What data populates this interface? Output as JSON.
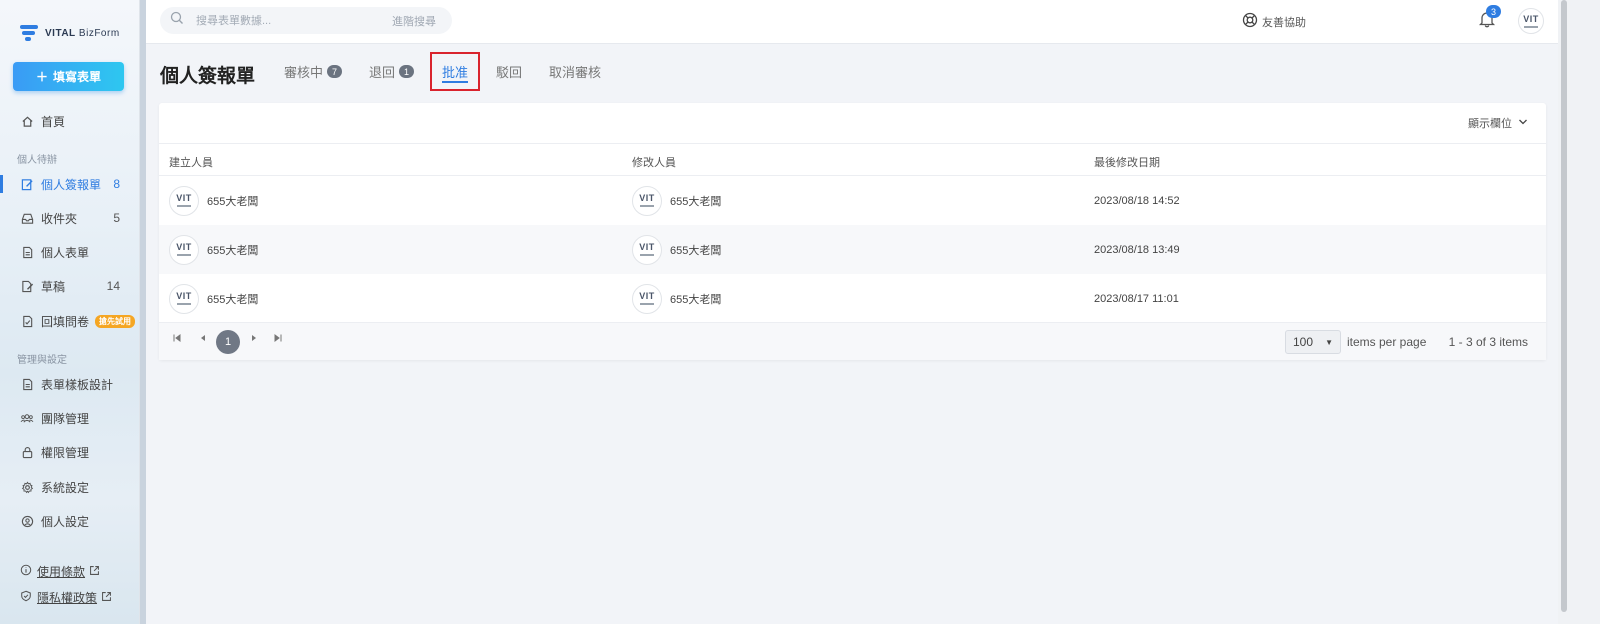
{
  "brand": {
    "name_bold": "VITAL",
    "name_light": " BizForm",
    "accent": "#2f7de1"
  },
  "sidebar": {
    "fill_button": "填寫表單",
    "home": "首頁",
    "section_personal": "個人待辦",
    "items": [
      {
        "label": "個人簽報單",
        "count": "8"
      },
      {
        "label": "收件夾",
        "count": "5"
      },
      {
        "label": "個人表單",
        "count": ""
      },
      {
        "label": "草稿",
        "count": "14"
      },
      {
        "label": "回填問卷",
        "badge": "搶先試用"
      }
    ],
    "section_admin": "管理與設定",
    "admin_items": [
      {
        "label": "表單樣板設計"
      },
      {
        "label": "團隊管理"
      },
      {
        "label": "權限管理"
      },
      {
        "label": "系統設定"
      },
      {
        "label": "個人設定"
      }
    ],
    "footer": {
      "terms": "使用條款",
      "privacy": "隱私權政策"
    }
  },
  "topbar": {
    "search_placeholder": "搜尋表單數據...",
    "advanced_search": "進階搜尋",
    "help": "友善協助",
    "notifications": "3",
    "avatar_text": "VIT"
  },
  "page": {
    "title": "個人簽報單",
    "tabs": [
      {
        "label": "審核中",
        "badge": "7"
      },
      {
        "label": "退回",
        "badge": "1"
      },
      {
        "label": "批准",
        "active": true
      },
      {
        "label": "駁回"
      },
      {
        "label": "取消審核"
      }
    ]
  },
  "table": {
    "column_toggle": "顯示欄位",
    "headers": [
      "建立人員",
      "修改人員",
      "最後修改日期"
    ],
    "rows": [
      {
        "creator": "655大老闆",
        "modifier": "655大老闆",
        "date": "2023/08/18 14:52"
      },
      {
        "creator": "655大老闆",
        "modifier": "655大老闆",
        "date": "2023/08/18 13:49"
      },
      {
        "creator": "655大老闆",
        "modifier": "655大老闆",
        "date": "2023/08/17 11:01"
      }
    ],
    "avatar_text": "VIT"
  },
  "pager": {
    "current_page": "1",
    "page_size": "100",
    "items_per_page_label": "items per page",
    "info": "1 - 3 of 3 items"
  }
}
